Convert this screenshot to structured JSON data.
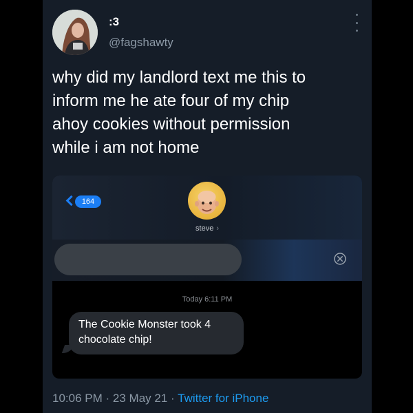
{
  "author": {
    "display_name": ":3",
    "handle": "@fagshawty"
  },
  "tweet": {
    "text_lines": [
      "why did my landlord text me this to",
      "inform me he ate four of my chip",
      "ahoy cookies without permission",
      "while i am not home"
    ],
    "time": "10:06 PM",
    "separator": "·",
    "date": "23 May 21",
    "source": "Twitter for iPhone"
  },
  "imessage": {
    "unread_count": "164",
    "contact_name": "steve",
    "contact_chevron": "›",
    "timestamp": "Today 6:11 PM",
    "message_lines": [
      "The Cookie Monster took 4",
      "chocolate chip!"
    ]
  },
  "icons": {
    "more": "more-options-icon",
    "back": "back-chevron-icon",
    "clear": "clear-icon"
  },
  "colors": {
    "card_background": "#151d28",
    "link_blue": "#1d9bf0",
    "imessage_blue": "#1b7ef5",
    "muted_text": "#8b98a5"
  }
}
